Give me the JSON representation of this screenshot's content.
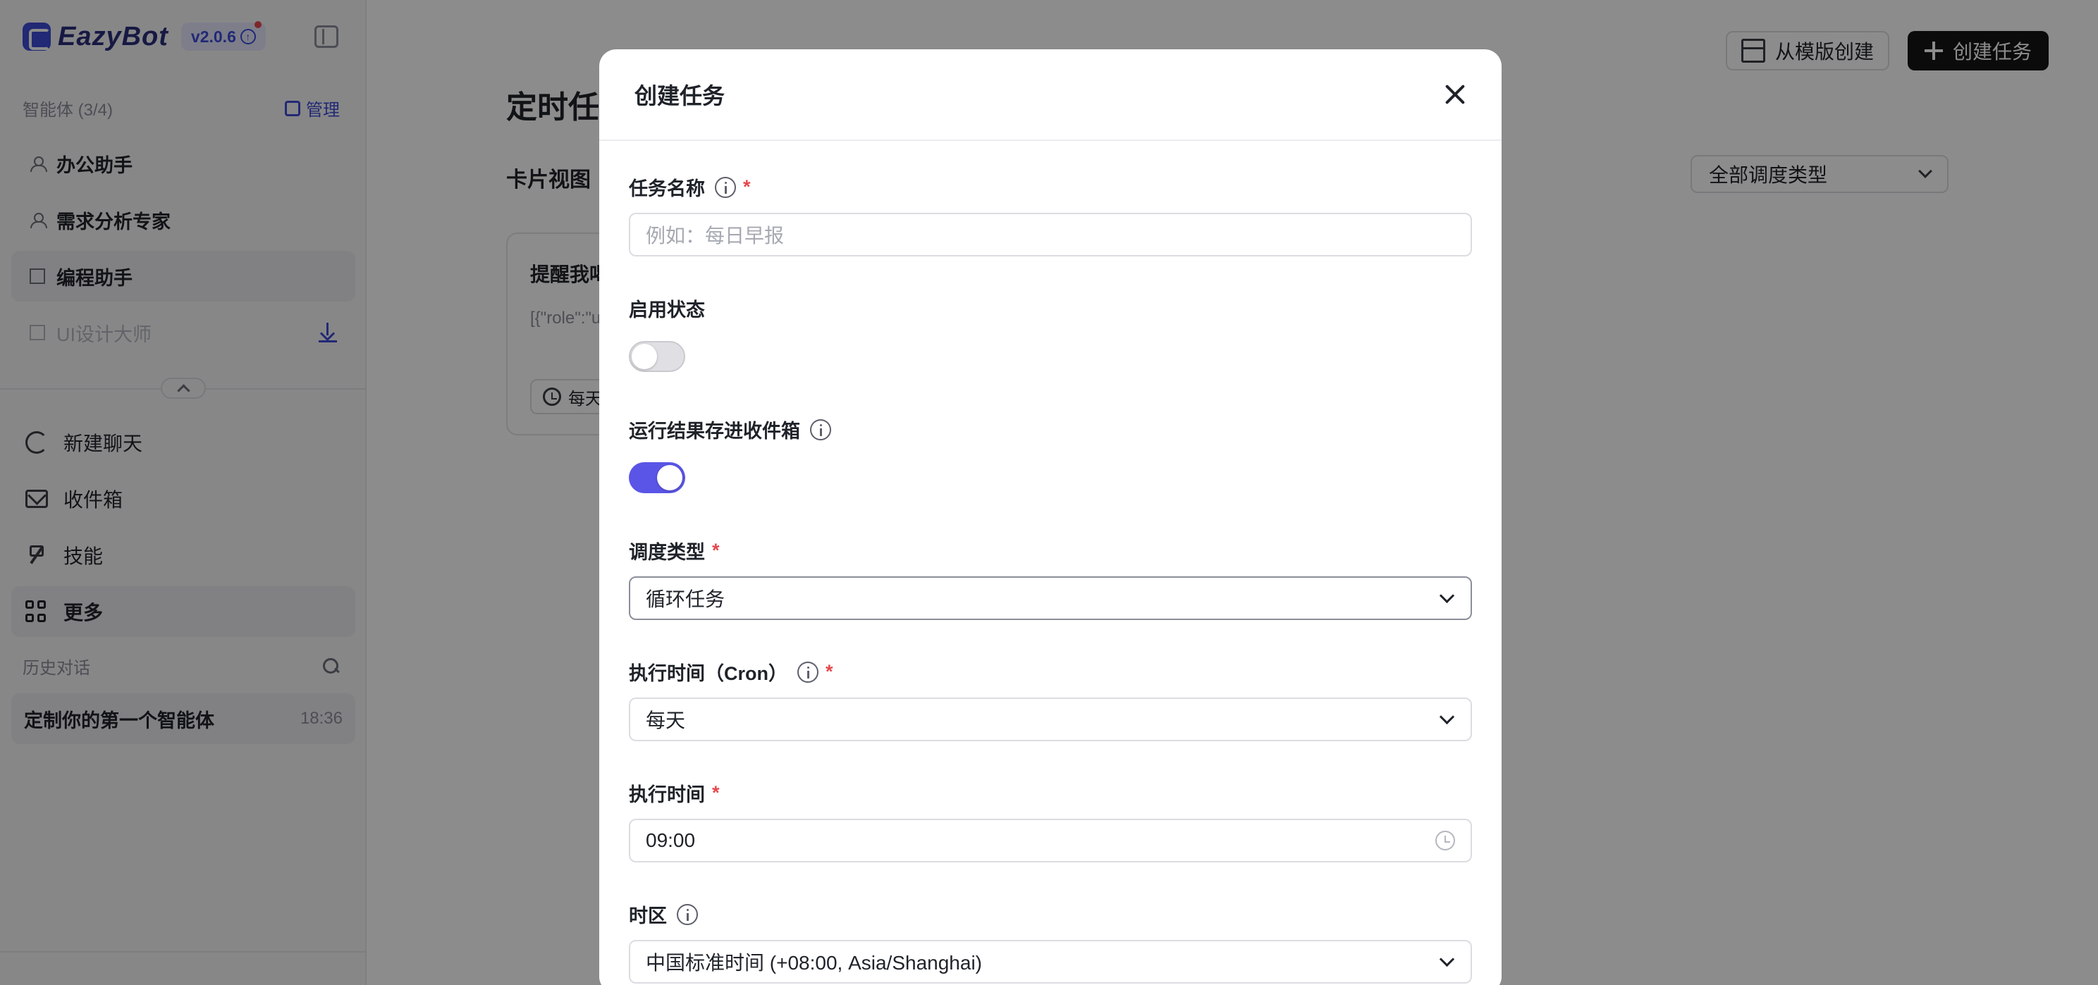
{
  "app": {
    "name": "EazyBot",
    "version": "v2.0.6"
  },
  "sidebar": {
    "agents_count": "智能体 (3/4)",
    "manage_label": "管理",
    "agents": [
      {
        "label": "办公助手",
        "icon": "person-icon"
      },
      {
        "label": "需求分析专家",
        "icon": "person-icon"
      },
      {
        "label": "编程助手",
        "icon": "building-icon"
      },
      {
        "label": "UI设计大师",
        "icon": "building-icon"
      }
    ],
    "nav": [
      {
        "label": "新建聊天",
        "icon": "new-chat-icon"
      },
      {
        "label": "收件箱",
        "icon": "mail-icon"
      },
      {
        "label": "技能",
        "icon": "tool-icon"
      },
      {
        "label": "更多",
        "icon": "grid-icon"
      }
    ],
    "history_label": "历史对话",
    "history": [
      {
        "title": "定制你的第一个智能体",
        "time": "18:36"
      }
    ]
  },
  "main": {
    "btn_template": "从模版创建",
    "btn_create": "创建任务",
    "page_title": "定时任务",
    "view_label": "卡片视图",
    "filter": "全部调度类型",
    "card": {
      "title": "提醒我喝水",
      "desc": "[{\"role\":\"user\",\"content\":\"提醒我喝水\"}]",
      "tag": "每天"
    }
  },
  "modal": {
    "title": "创建任务",
    "fields": {
      "name_label": "任务名称",
      "name_placeholder": "例如：每日早报",
      "enable_label": "启用状态",
      "enable_on": false,
      "inbox_label": "运行结果存进收件箱",
      "inbox_on": true,
      "schedule_label": "调度类型",
      "schedule_value": "循环任务",
      "cron_label": "执行时间（Cron）",
      "cron_value": "每天",
      "time_label": "执行时间",
      "time_value": "09:00",
      "tz_label": "时区",
      "tz_value": "中国标准时间 (+08:00, Asia/Shanghai)"
    }
  },
  "colors": {
    "accent": "#3e4bd6",
    "toggle_on": "#5a55e6",
    "required": "#e5484d",
    "primary_button": "#141414"
  }
}
